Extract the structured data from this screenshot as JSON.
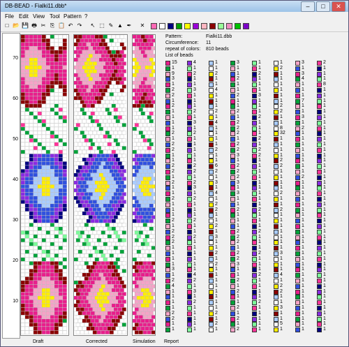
{
  "window": {
    "title": "DB-BEAD - Fialki11.dbb*",
    "min": "–",
    "max": "□",
    "close": "✕"
  },
  "menu": [
    "File",
    "Edit",
    "View",
    "Tool",
    "Pattern",
    "?"
  ],
  "toolbar": {
    "icons": [
      "new-icon",
      "open-icon",
      "save-icon",
      "print-icon",
      "cut-icon",
      "copy-icon",
      "paste-icon",
      "undo-icon",
      "redo-icon",
      "arrow-icon",
      "select-icon",
      "pencil-icon",
      "fill-icon",
      "eyedropper-icon",
      "close-icon"
    ],
    "glyphs": [
      "□",
      "📂",
      "💾",
      "🖶",
      "✂",
      "⎘",
      "📋",
      "↶",
      "↷",
      "↖",
      "⬚",
      "✎",
      "▲",
      "✒",
      "✕"
    ],
    "swatches": [
      "#ff69b4",
      "#ffffff",
      "#000080",
      "#00a000",
      "#ffff00",
      "#9b00d8",
      "#ffb6c1",
      "#8b0000",
      "#98fb98",
      "#f08bc0",
      "#00c000",
      "#7b00c8"
    ]
  },
  "ruler": {
    "labels": [
      "70",
      "60",
      "50",
      "40",
      "30",
      "20",
      "10"
    ]
  },
  "info": {
    "pattern_label": "Pattern:",
    "pattern": "Fialki11.dbb",
    "circ_label": "Circumference:",
    "circ": "11",
    "repeat_label": "repeat of colors:",
    "repeat": "810 beads",
    "list_label": "List of beads"
  },
  "tabs": [
    "Draft",
    "Corrected",
    "Simulation",
    "Report"
  ],
  "palette": {
    "pink": "#e91e8c",
    "white": "#ffffff",
    "navy": "#000080",
    "green": "#00a33a",
    "yellow": "#ffee00",
    "purple": "#8a2be2",
    "lpink": "#f5a3c7",
    "maroon": "#8b0000",
    "lgreen": "#7cfc9a",
    "blue": "#3050e0",
    "lblue": "#aaccff",
    "magenta": "#ff3399"
  },
  "bead_columns": [
    [
      "15",
      "1",
      "9",
      "3",
      "1",
      "2",
      "2",
      "1",
      "2",
      "1",
      "1",
      "1",
      "1",
      "2",
      "1",
      "2",
      "2",
      "1",
      "1",
      "2",
      "2",
      "1",
      "2",
      "1",
      "1",
      "2",
      "1",
      "1",
      "1",
      "2",
      "1",
      "2",
      "2",
      "2",
      "1",
      "1",
      "1",
      "1",
      "3",
      "1",
      "2",
      "4",
      "1",
      "1",
      "1",
      "1",
      "2",
      "2",
      "1",
      "1"
    ],
    [
      "4",
      "1",
      "2",
      "1",
      "1",
      "3",
      "1",
      "1",
      "1",
      "2",
      "1",
      "3",
      "1",
      "2",
      "1",
      "1",
      "1",
      "1",
      "1",
      "2",
      "2",
      "1",
      "2",
      "3",
      "1",
      "2",
      "1",
      "1",
      "1",
      "2",
      "1",
      "1",
      "2",
      "1",
      "1",
      "1",
      "1",
      "1",
      "1",
      "4",
      "2",
      "1",
      "3",
      "1",
      "2",
      "1",
      "1",
      "1",
      "1",
      "1"
    ],
    [
      "1",
      "1",
      "2",
      "1",
      "1",
      "4",
      "1",
      "1",
      "1",
      "2",
      "1",
      "4",
      "1",
      "1",
      "1",
      "1",
      "2",
      "1",
      "1",
      "6",
      "2",
      "1",
      "3",
      "1",
      "4",
      "1",
      "2",
      "2",
      "1",
      "1",
      "2",
      "1",
      "3",
      "1",
      "1",
      "2",
      "1",
      "2",
      "1",
      "1",
      "1",
      "1",
      "1",
      "1",
      "1",
      "1",
      "2",
      "1",
      "2",
      "1"
    ],
    [
      "3",
      "1",
      "1",
      "2",
      "1",
      "1",
      "2",
      "1",
      "1",
      "2",
      "1",
      "2",
      "2",
      "2",
      "1",
      "2",
      "2",
      "3",
      "1",
      "2",
      "2",
      "2",
      "3",
      "1",
      "3",
      "1",
      "1",
      "2",
      "1",
      "1",
      "1",
      "2",
      "2",
      "2",
      "1",
      "2",
      "2",
      "3",
      "1",
      "1",
      "2",
      "1",
      "2",
      "1",
      "1",
      "2",
      "1",
      "2",
      "1",
      "2"
    ],
    [
      "1",
      "1",
      "2",
      "1",
      "1",
      "1",
      "3",
      "1",
      "1",
      "1",
      "2",
      "1",
      "1",
      "1",
      "2",
      "1",
      "2",
      "2",
      "1",
      "1",
      "1",
      "1",
      "1",
      "1",
      "1",
      "1",
      "1",
      "2",
      "1",
      "1",
      "1",
      "2",
      "1",
      "1",
      "1",
      "2",
      "1",
      "1",
      "1",
      "2",
      "1",
      "1",
      "1",
      "1",
      "2",
      "1",
      "1",
      "1",
      "1",
      "1"
    ],
    [
      "1",
      "2",
      "1",
      "1",
      "1",
      "1",
      "1",
      "1",
      "2",
      "2",
      "1",
      "1",
      "8",
      "32",
      "1",
      "1",
      "1",
      "1",
      "2",
      "2",
      "1",
      "1",
      "1",
      "1",
      "2",
      "1",
      "1",
      "2",
      "1",
      "1",
      "1",
      "1",
      "1",
      "1",
      "1",
      "3",
      "1",
      "1",
      "1",
      "4",
      "1",
      "2",
      "2",
      "1",
      "1",
      "3",
      "1",
      "1",
      "5",
      "1"
    ],
    [
      "3",
      "1",
      "3",
      "4",
      "1",
      "1",
      "1",
      "7",
      "1",
      "1",
      "3",
      "1",
      "2",
      "1",
      "1",
      "1",
      "1",
      "1",
      "1",
      "1",
      "1",
      "2",
      "1",
      "1",
      "1",
      "1",
      "1",
      "1",
      "1",
      "1",
      "1",
      "1",
      "1",
      "1",
      "1",
      "1",
      "1",
      "1",
      "1",
      "1",
      "1",
      "1",
      "1",
      "1",
      "1",
      "1",
      "1",
      "1",
      "1",
      "1"
    ],
    [
      "2",
      "1",
      "1",
      "1",
      "8",
      "1",
      "1",
      "1",
      "1",
      "1",
      "1",
      "1",
      "1",
      "1",
      "1",
      "1",
      "1",
      "1",
      "1",
      "1",
      "1",
      "1",
      "1",
      "1",
      "1",
      "1",
      "1",
      "1",
      "1",
      "1",
      "1",
      "1",
      "1",
      "1",
      "1",
      "1",
      "1",
      "1",
      "1",
      "1",
      "1",
      "1",
      "1",
      "1",
      "1",
      "1",
      "1",
      "1",
      "1",
      "1"
    ]
  ]
}
